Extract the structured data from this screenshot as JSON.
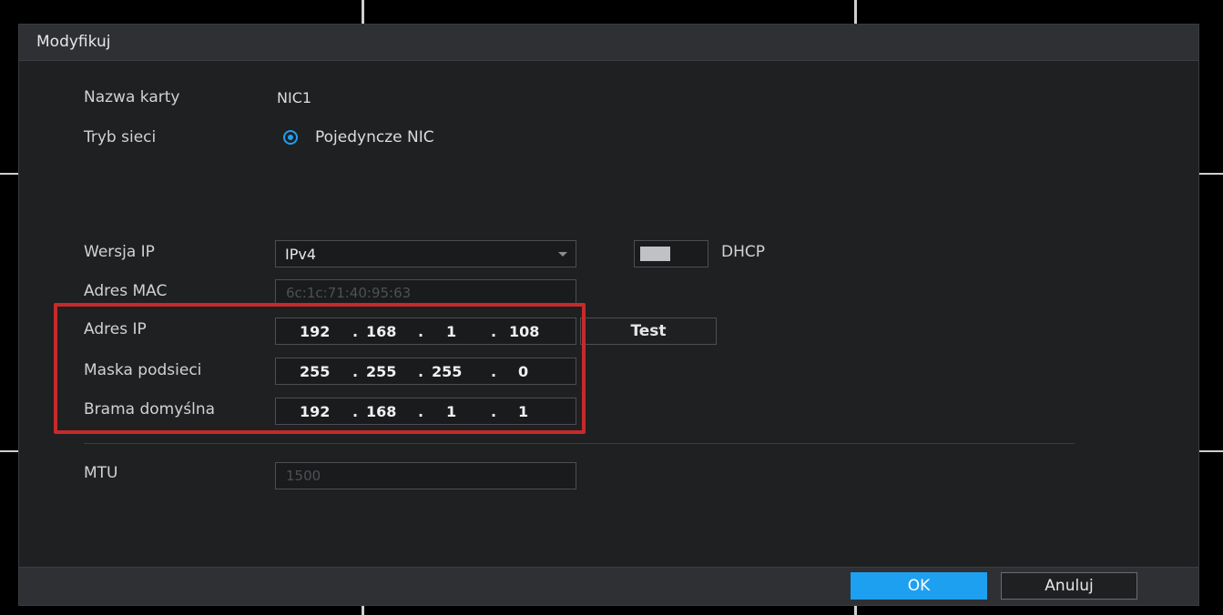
{
  "dialog": {
    "title": "Modyfikuj"
  },
  "card": {
    "name_label": "Nazwa karty",
    "name_value": "NIC1"
  },
  "mode": {
    "label": "Tryb sieci",
    "option": "Pojedyncze NIC",
    "selected": true
  },
  "ip_version": {
    "label": "Wersja IP",
    "value": "IPv4",
    "dhcp_label": "DHCP",
    "dhcp_enabled": false
  },
  "mac": {
    "label": "Adres MAC",
    "value": "6c:1c:71:40:95:63"
  },
  "ip": {
    "label": "Adres IP",
    "octets": [
      "192",
      "168",
      "1",
      "108"
    ],
    "test_label": "Test"
  },
  "mask": {
    "label": "Maska podsieci",
    "octets": [
      "255",
      "255",
      "255",
      "0"
    ]
  },
  "gateway": {
    "label": "Brama domyślna",
    "octets": [
      "192",
      "168",
      "1",
      "1"
    ]
  },
  "mtu": {
    "label": "MTU",
    "value": "1500"
  },
  "footer": {
    "ok_label": "OK",
    "cancel_label": "Anuluj"
  },
  "colors": {
    "accent": "#1ea0f0",
    "highlight": "#c62a2a",
    "background": "#1f2022"
  }
}
